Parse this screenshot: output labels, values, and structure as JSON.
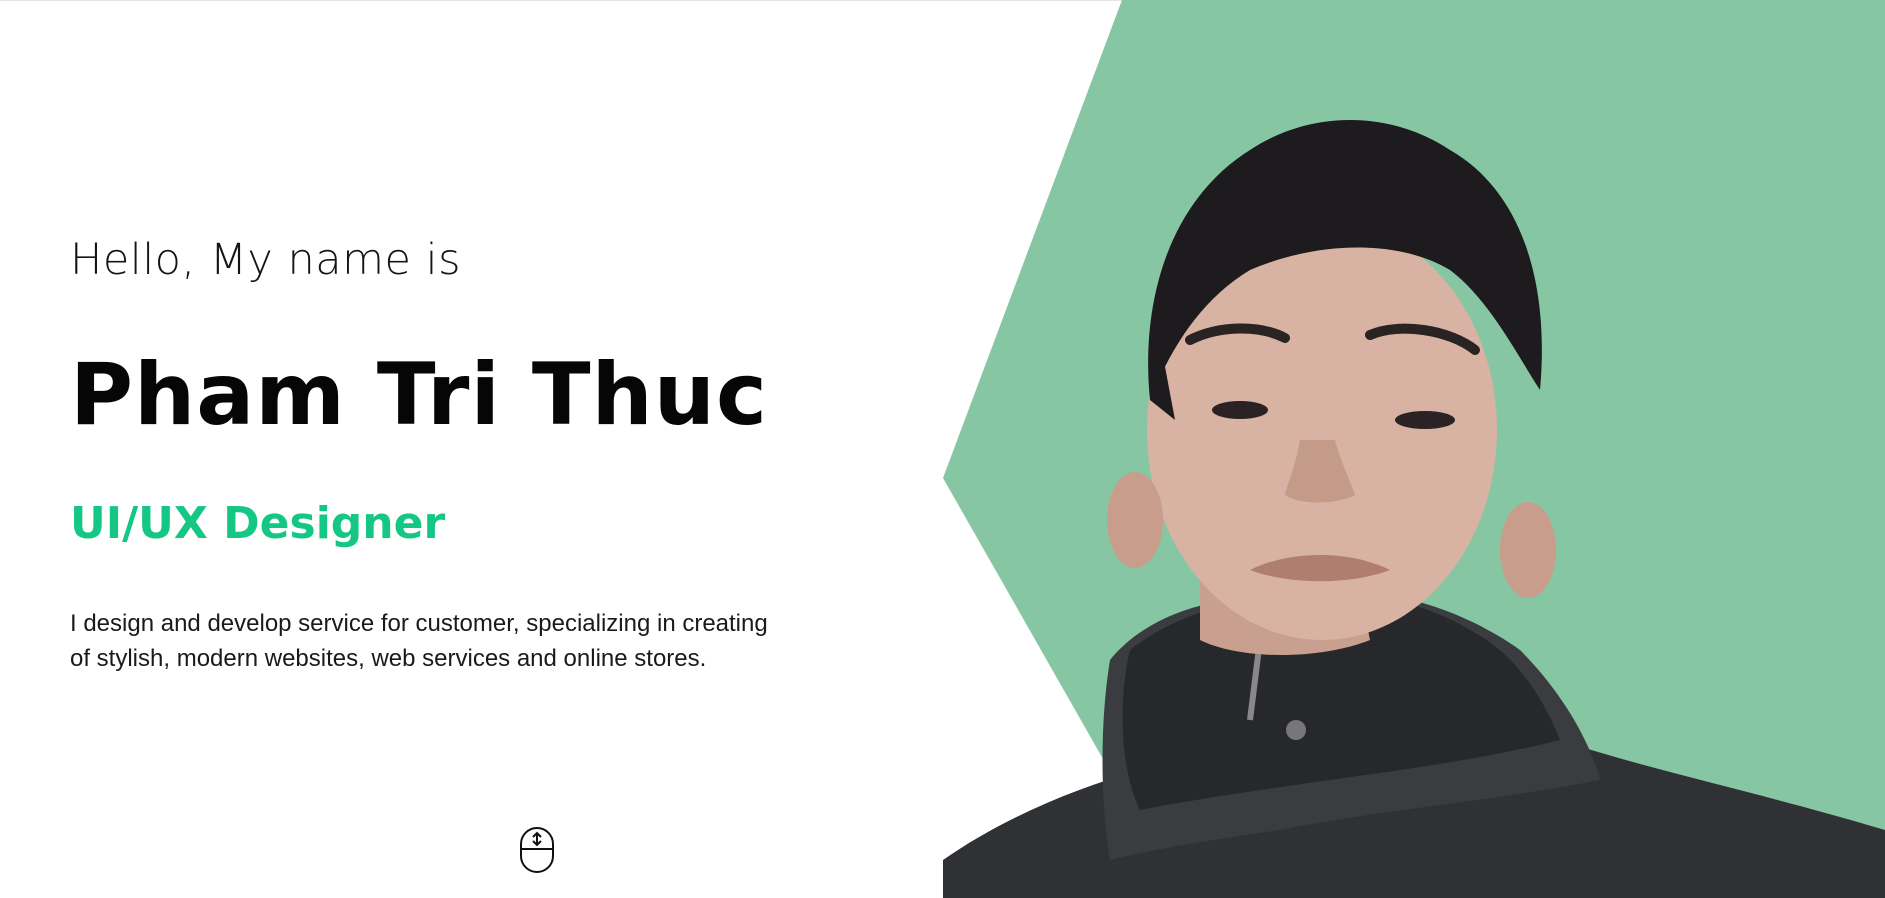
{
  "hero": {
    "greeting": "Hello, My name is",
    "name": "Pham Tri Thuc",
    "role": "UI/UX Designer",
    "bio_line1": "I design and develop service for customer, specializing in creating",
    "bio_line2": "of stylish, modern websites, web services and online stores."
  },
  "portrait": {
    "icon": "person-portrait-photo"
  },
  "scroll_indicator": {
    "icon": "mouse-scroll-icon"
  },
  "colors": {
    "accent": "#14c785",
    "backdrop": "#87c6a3",
    "text": "#111111",
    "background": "#ffffff"
  }
}
